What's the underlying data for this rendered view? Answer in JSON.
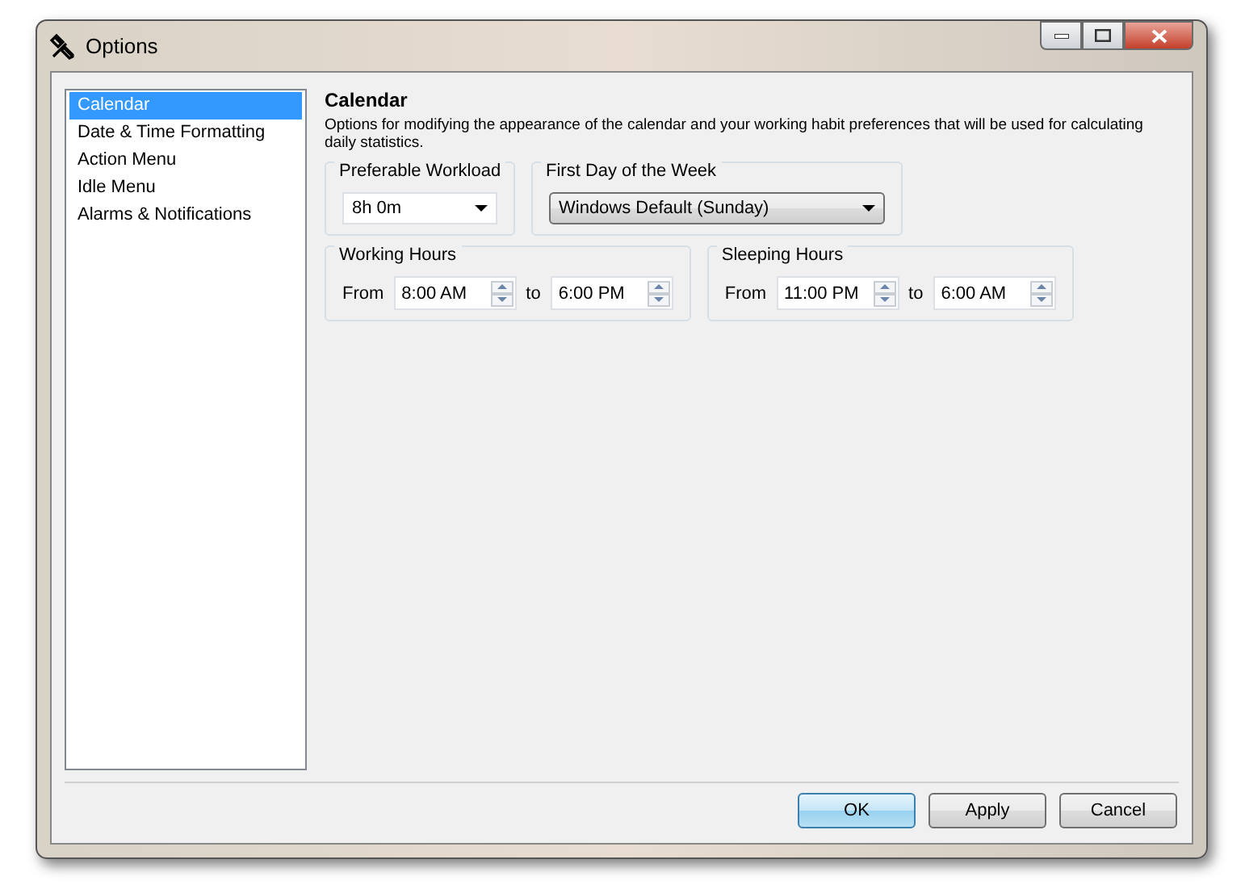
{
  "window": {
    "title": "Options"
  },
  "sidebar": {
    "items": [
      {
        "label": "Calendar",
        "selected": true
      },
      {
        "label": "Date & Time Formatting",
        "selected": false
      },
      {
        "label": "Action Menu",
        "selected": false
      },
      {
        "label": "Idle Menu",
        "selected": false
      },
      {
        "label": "Alarms & Notifications",
        "selected": false
      }
    ]
  },
  "section": {
    "title": "Calendar",
    "description": "Options for modifying the appearance of the calendar and your working habit preferences that will be used for calculating daily statistics."
  },
  "dropdown_groups": [
    {
      "label": "Preferable Workload",
      "value": "8h 0m",
      "kind": "field"
    },
    {
      "label": "First Day of the Week",
      "value": "Windows Default (Sunday)",
      "kind": "button"
    }
  ],
  "range_groups": [
    {
      "label": "Working Hours",
      "from_label": "From",
      "from": "8:00 AM",
      "to_label": "to",
      "to": "6:00 PM"
    },
    {
      "label": "Sleeping Hours",
      "from_label": "From",
      "from": "11:00 PM",
      "to_label": "to",
      "to": "6:00 AM"
    }
  ],
  "buttons": [
    {
      "label": "OK",
      "default": true
    },
    {
      "label": "Apply",
      "default": false
    },
    {
      "label": "Cancel",
      "default": false
    }
  ]
}
